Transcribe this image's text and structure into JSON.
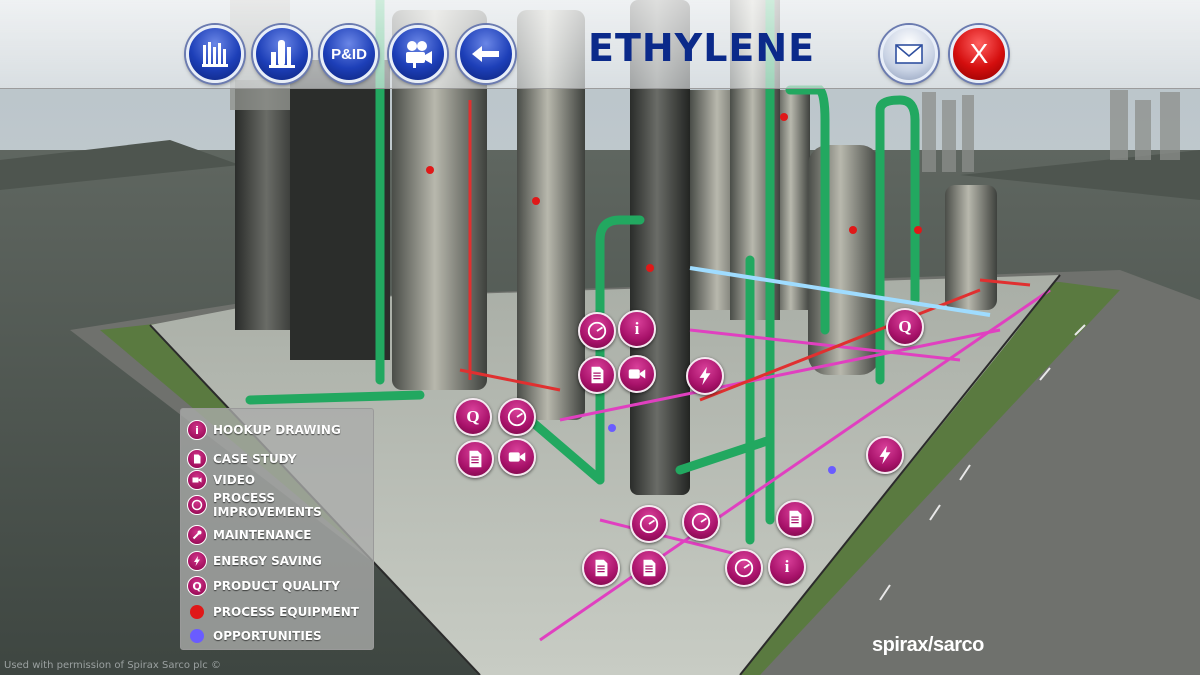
{
  "header": {
    "title": "ETHYLENE",
    "nav": [
      {
        "name": "plant-overview-button",
        "icon": "plant-icon"
      },
      {
        "name": "distillation-column-button",
        "icon": "column-icon"
      },
      {
        "name": "pid-button",
        "label": "P&ID"
      },
      {
        "name": "video-camera-button",
        "icon": "video-camera-icon"
      },
      {
        "name": "back-button",
        "icon": "arrow-left-icon"
      }
    ],
    "mail_icon": "envelope-icon",
    "close_label": "X"
  },
  "legend": {
    "items": [
      {
        "label": "HOOKUP DRAWING",
        "icon": "info-icon",
        "glyph": "i"
      },
      {
        "label": "CASE STUDY",
        "icon": "document-icon"
      },
      {
        "label": "VIDEO",
        "icon": "video-icon"
      },
      {
        "label": "PROCESS IMPROVEMENTS",
        "icon": "gauge-icon"
      },
      {
        "label": "MAINTENANCE",
        "icon": "wrench-icon"
      },
      {
        "label": "ENERGY SAVING",
        "icon": "lightning-icon"
      },
      {
        "label": "PRODUCT QUALITY",
        "icon": "quality-icon",
        "glyph": "Q"
      },
      {
        "label": "PROCESS EQUIPMENT",
        "color": "#e01818"
      },
      {
        "label": "OPPORTUNITIES",
        "color": "#6a5cff"
      }
    ]
  },
  "hotspots": {
    "info_glyph": "i",
    "quality_glyph": "Q"
  },
  "colors": {
    "hotspot": "#a8126a",
    "title": "#0b2a8a",
    "nav": "#1d3fb8",
    "pipe_green": "#22a860",
    "pipe_magenta": "#e040c0"
  },
  "brand": "spirax/sarco",
  "credit": "Used with permission of Spirax Sarco plc ©"
}
